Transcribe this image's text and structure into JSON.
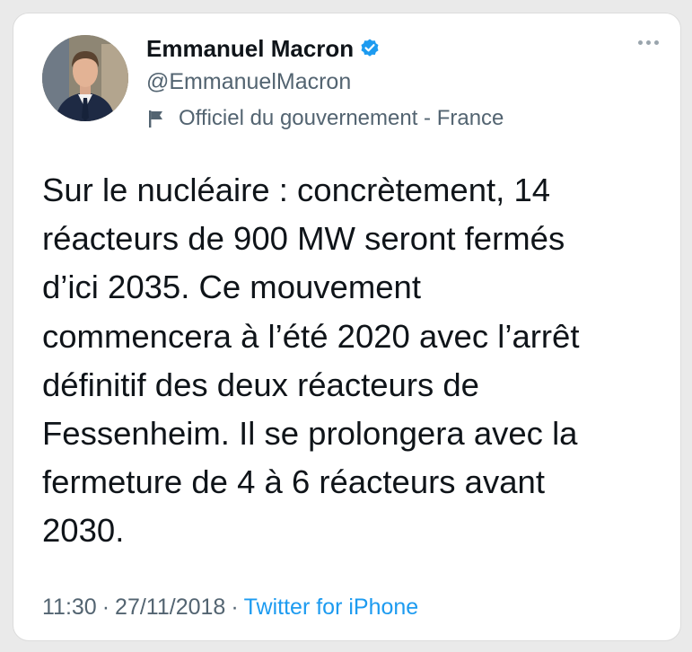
{
  "tweet": {
    "author": {
      "name": "Emmanuel Macron",
      "handle": "@EmmanuelMacron",
      "verified_icon": "verified-badge-icon",
      "account_label": "Officiel du gouvernement - France",
      "label_icon": "flag-icon"
    },
    "more_icon": "more-options-icon",
    "text": "Sur le nucléaire : concrètement, 14\nréacteurs de 900 MW seront fermés\nd’ici 2035. Ce mouvement\ncommencera à l’été 2020 avec l’arrêt\ndéfinitif des deux réacteurs de\nFessenheim. Il se prolongera avec la\nfermeture de 4 à 6 réacteurs avant\n2030.",
    "time": "11:30",
    "date": "27/11/2018",
    "separator": "·",
    "source": "Twitter for iPhone"
  },
  "colors": {
    "text": "#0f1419",
    "secondary": "#536471",
    "link": "#1d9bf0",
    "verified": "#1d9bf0"
  }
}
